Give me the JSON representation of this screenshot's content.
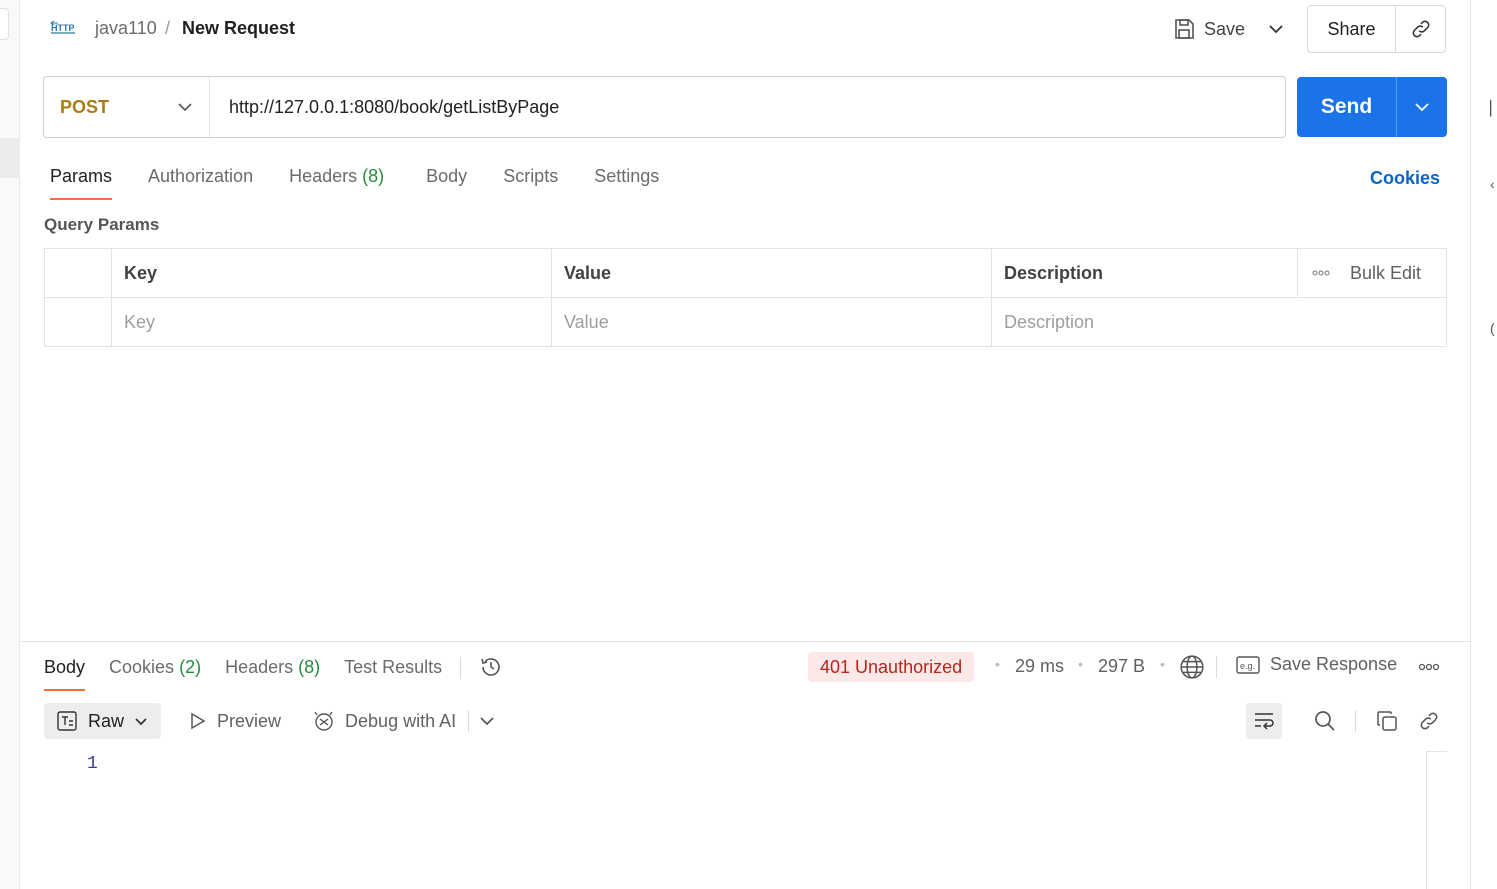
{
  "header": {
    "collection": "java110",
    "separator": "/",
    "title": "New Request",
    "save_label": "Save",
    "share_label": "Share"
  },
  "request": {
    "method": "POST",
    "url": "http://127.0.0.1:8080/book/getListByPage",
    "send_label": "Send"
  },
  "tabs": [
    {
      "label": "Params",
      "active": true
    },
    {
      "label": "Authorization"
    },
    {
      "label": "Headers",
      "count": "(8)"
    },
    {
      "label": "Body"
    },
    {
      "label": "Scripts"
    },
    {
      "label": "Settings"
    }
  ],
  "cookies_link": "Cookies",
  "query_params": {
    "title": "Query Params",
    "columns": [
      "Key",
      "Value",
      "Description"
    ],
    "bulk_edit": "Bulk Edit",
    "placeholders": [
      "Key",
      "Value",
      "Description"
    ]
  },
  "response": {
    "tabs": [
      {
        "label": "Body",
        "active": true
      },
      {
        "label": "Cookies",
        "count": "(2)"
      },
      {
        "label": "Headers",
        "count": "(8)"
      },
      {
        "label": "Test Results"
      }
    ],
    "status": "401 Unauthorized",
    "time": "29 ms",
    "size": "297 B",
    "save_response": "Save Response",
    "format": "Raw",
    "preview": "Preview",
    "debug": "Debug with AI",
    "line_number": "1"
  },
  "colors": {
    "accent": "#1a73e8",
    "method": "#a67d16",
    "tab_indicator": "#ff6c37",
    "status_error": "#b3261e"
  }
}
